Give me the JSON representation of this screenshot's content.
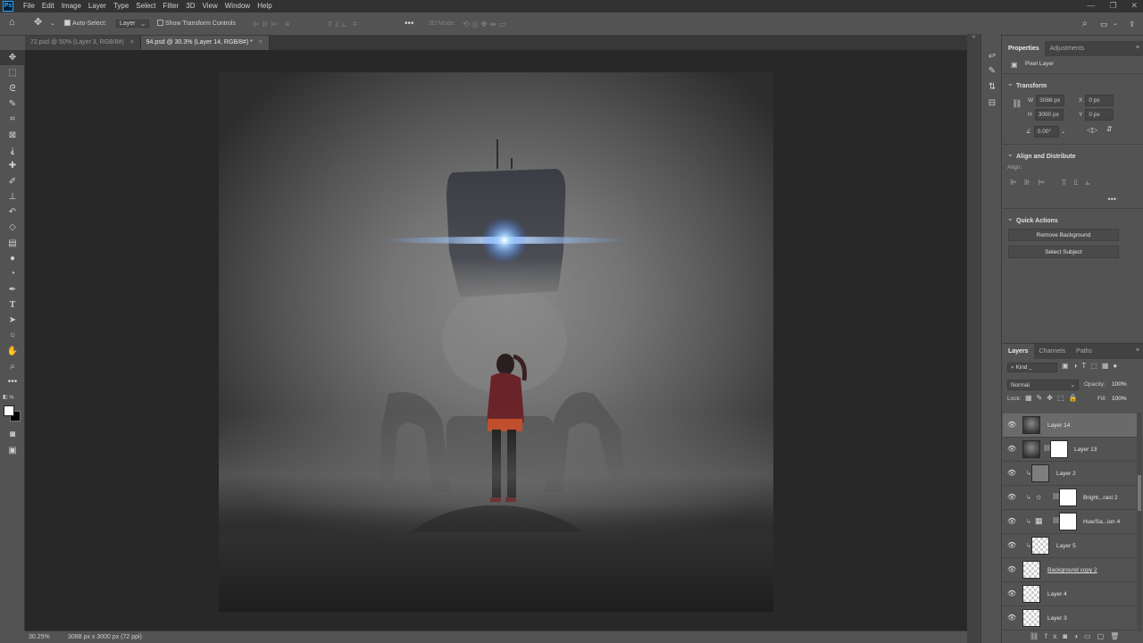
{
  "app": {
    "logo": "Ps"
  },
  "menubar": {
    "items": [
      "File",
      "Edit",
      "Image",
      "Layer",
      "Type",
      "Select",
      "Filter",
      "3D",
      "View",
      "Window",
      "Help"
    ]
  },
  "options": {
    "auto_select_label": "Auto-Select:",
    "auto_select_checked": true,
    "auto_select_target": "Layer",
    "show_transform_label": "Show Transform Controls",
    "show_transform_checked": false,
    "mode_3d_label": "3D Mode:"
  },
  "tabs": [
    {
      "label": "72.psd @ 50% (Layer 3, RGB/8#)",
      "active": false
    },
    {
      "label": "94.psd @ 30.3% (Layer 14, RGB/8#) *",
      "active": true
    }
  ],
  "tools": [
    "move-tool",
    "marquee-tool",
    "lasso-tool",
    "quick-select-tool",
    "crop-tool",
    "frame-tool",
    "eyedropper-tool",
    "healing-brush-tool",
    "brush-tool",
    "clone-stamp-tool",
    "history-brush-tool",
    "eraser-tool",
    "gradient-tool",
    "blur-tool",
    "dodge-tool",
    "pen-tool",
    "type-tool",
    "path-selection-tool",
    "shape-tool",
    "hand-tool",
    "zoom-tool",
    "more-tools"
  ],
  "colors": {
    "foreground": "#ffffff",
    "background": "#000000",
    "ui_bg": "#535353",
    "selected_row": "#6a6a6a"
  },
  "properties": {
    "tabs": [
      "Properties",
      "Adjustments"
    ],
    "layer_kind": "Pixel Layer",
    "transform": {
      "title": "Transform",
      "w_label": "W",
      "w": "3088 px",
      "h_label": "H",
      "h": "3000 px",
      "x_label": "X",
      "x": "0 px",
      "y_label": "Y",
      "y": "0 px",
      "angle": "0.00°"
    },
    "align": {
      "title": "Align and Distribute",
      "label": "Align:"
    },
    "quick_actions": {
      "title": "Quick Actions",
      "remove_bg": "Remove Background",
      "select_subject": "Select Subject"
    }
  },
  "layers_panel": {
    "tabs": [
      "Layers",
      "Channels",
      "Paths"
    ],
    "filter": "Kind",
    "blend_mode": "Normal",
    "opacity_label": "Opacity:",
    "opacity": "100%",
    "lock_label": "Lock:",
    "fill_label": "Fill:",
    "fill": "100%",
    "layers": [
      {
        "name": "Layer 14",
        "thumb": "dark",
        "selected": true,
        "clipped": false,
        "mask": false
      },
      {
        "name": "Layer 13",
        "thumb": "dark",
        "selected": false,
        "clipped": false,
        "mask": true
      },
      {
        "name": "Layer 2",
        "thumb": "grey",
        "selected": false,
        "clipped": true,
        "mask": false
      },
      {
        "name": "Bright...rast 2",
        "thumb": "adjust-brightness",
        "selected": false,
        "clipped": true,
        "mask": true
      },
      {
        "name": "Hue/Sa...ion 4",
        "thumb": "adjust-hue",
        "selected": false,
        "clipped": true,
        "mask": true
      },
      {
        "name": "Layer 5",
        "thumb": "check",
        "selected": false,
        "clipped": true,
        "mask": false
      },
      {
        "name": "Background copy 2",
        "thumb": "check",
        "selected": false,
        "clipped": false,
        "mask": false
      },
      {
        "name": "Layer 4",
        "thumb": "check",
        "selected": false,
        "clipped": false,
        "mask": false
      },
      {
        "name": "Layer 3",
        "thumb": "check",
        "selected": false,
        "clipped": false,
        "mask": false
      }
    ]
  },
  "status": {
    "zoom": "30.25%",
    "doc_info": "3088 px x 3000 px (72 ppi)"
  }
}
